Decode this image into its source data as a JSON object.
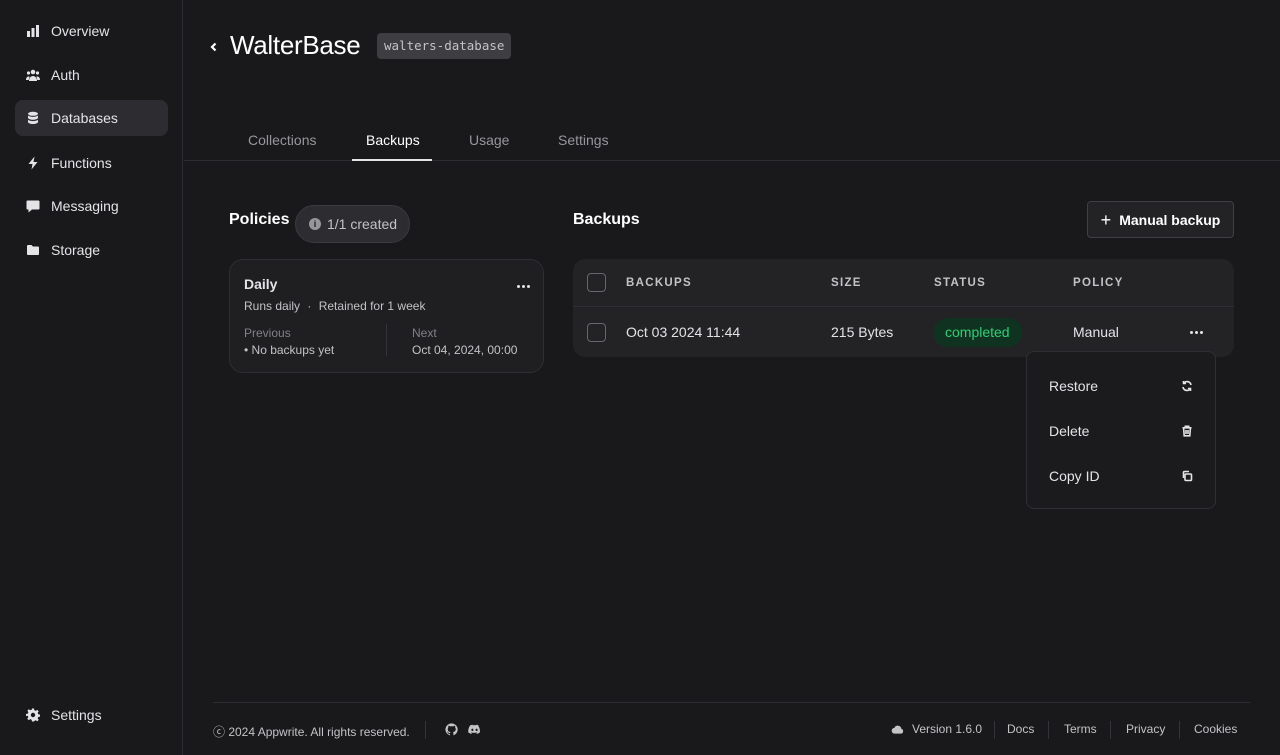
{
  "sidebar": {
    "items": [
      {
        "label": "Overview",
        "icon": "chart-bar-icon"
      },
      {
        "label": "Auth",
        "icon": "users-icon"
      },
      {
        "label": "Databases",
        "icon": "database-icon",
        "active": true
      },
      {
        "label": "Functions",
        "icon": "lightning-icon"
      },
      {
        "label": "Messaging",
        "icon": "chat-icon"
      },
      {
        "label": "Storage",
        "icon": "folder-icon"
      }
    ],
    "settings_label": "Settings"
  },
  "header": {
    "title": "WalterBase",
    "database_id": "walters-database"
  },
  "tabs": [
    "Collections",
    "Backups",
    "Usage",
    "Settings"
  ],
  "active_tab": "Backups",
  "policies": {
    "title": "Policies",
    "created_count": "1/1 created",
    "card": {
      "name": "Daily",
      "frequency": "Runs daily",
      "retention": "Retained for 1 week",
      "previous_label": "Previous",
      "previous_value": "• No backups yet",
      "next_label": "Next",
      "next_value": "Oct 04, 2024, 00:00"
    }
  },
  "backups": {
    "title": "Backups",
    "manual_button": "Manual backup",
    "columns": [
      "BACKUPS",
      "SIZE",
      "STATUS",
      "POLICY"
    ],
    "rows": [
      {
        "backup": "Oct 03 2024 11:44",
        "size": "215 Bytes",
        "status": "completed",
        "policy": "Manual"
      }
    ]
  },
  "row_menu": {
    "items": [
      {
        "label": "Restore",
        "icon": "restore-icon"
      },
      {
        "label": "Delete",
        "icon": "trash-icon"
      },
      {
        "label": "Copy ID",
        "icon": "copy-icon"
      }
    ]
  },
  "footer": {
    "copyright": "ⓒ 2024 Appwrite. All rights reserved.",
    "version": "Version 1.6.0",
    "links": [
      "Docs",
      "Terms",
      "Privacy",
      "Cookies"
    ]
  },
  "colors": {
    "background": "#19191c",
    "status_completed_bg": "#0f3320",
    "status_completed_text": "#2fcf72"
  }
}
